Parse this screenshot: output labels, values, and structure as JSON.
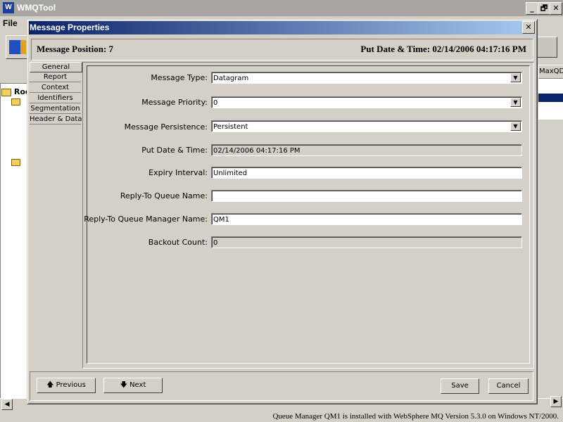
{
  "app": {
    "title": "WMQTool",
    "icon_letter": "W",
    "menu": [
      "File"
    ]
  },
  "tree": {
    "root_label": "Roo"
  },
  "table": {
    "column_header": "MaxQD"
  },
  "window_controls": {
    "minimize": "_",
    "restore": "🗗",
    "close": "✕"
  },
  "status_bar": {
    "text": "Queue Manager QM1 is installed with WebSphere MQ Version 5.3.0 on Windows NT/2000."
  },
  "dialog": {
    "title": "Message Properties",
    "close_glyph": "✕",
    "message_position_label": "Message Position: 7",
    "put_datetime_label": "Put Date & Time: 02/14/2006 04:17:16 PM",
    "tabs": [
      "General",
      "Report",
      "Context",
      "Identifiers",
      "Segmentation",
      "Header & Data"
    ],
    "active_tab": "General",
    "fields": {
      "message_type": {
        "label": "Message Type:",
        "value": "Datagram"
      },
      "message_priority": {
        "label": "Message Priority:",
        "value": "0"
      },
      "message_persistence": {
        "label": "Message Persistence:",
        "value": "Persistent"
      },
      "put_date_time": {
        "label": "Put Date & Time:",
        "value": "02/14/2006 04:17:16 PM"
      },
      "expiry_interval": {
        "label": "Expiry Interval:",
        "value": "Unlimited"
      },
      "reply_to_queue_name": {
        "label": "Reply-To Queue Name:",
        "value": ""
      },
      "reply_to_queue_manager_name": {
        "label": "Reply-To Queue Manager Name:",
        "value": "QM1"
      },
      "backout_count": {
        "label": "Backout Count:",
        "value": "0"
      }
    },
    "buttons": {
      "previous": "Previous",
      "next": "Next",
      "save": "Save",
      "cancel": "Cancel"
    },
    "dropdown_arrow": "▼",
    "up_arrow": "🡅",
    "down_arrow": "🡇"
  }
}
